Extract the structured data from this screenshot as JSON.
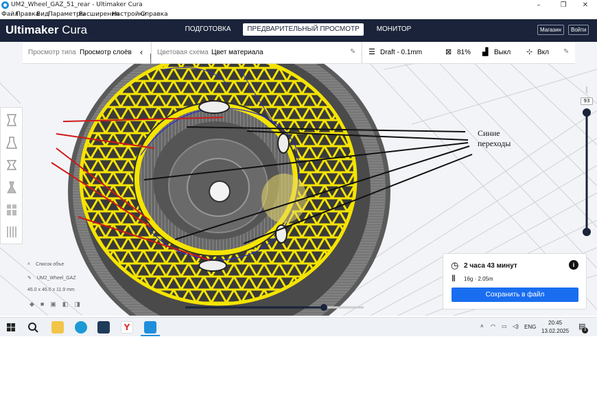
{
  "window": {
    "title": "UM2_Wheel_GAZ_51_rear - Ultimaker Cura",
    "controls": {
      "minimize": "–",
      "maximize": "❐",
      "close": "✕"
    }
  },
  "menu": {
    "items": [
      "Файл",
      "Правка",
      "Вид",
      "Параметры",
      "Расширения",
      "Настройки",
      "Справка"
    ]
  },
  "header": {
    "logo_bold": "Ultimaker",
    "logo_light": "Cura",
    "tabs": [
      "ПОДГОТОВКА",
      "ПРЕДВАРИТЕЛЬНЫЙ ПРОСМОТР",
      "МОНИТОР"
    ],
    "active_tab": 1,
    "marketplace": "Магазин",
    "signin": "Войти"
  },
  "view_bar": {
    "label": "Просмотр типа",
    "value": "Просмотр слоёв"
  },
  "color_bar": {
    "label": "Цветовая схема",
    "value": "Цвет материала"
  },
  "print_bar": {
    "profile": "Draft - 0.1mm",
    "infill": "81%",
    "support": "Выкл",
    "adhesion": "Вкл"
  },
  "object_list": {
    "header": "Список объе",
    "name": "UM2_Wheel_GAZ",
    "dims": "46.0 x 46.0 x 11.9 mm"
  },
  "layer_slider": {
    "value": "93"
  },
  "print_info": {
    "time": "2 часа 43 минут",
    "material": "16g · 2.05m",
    "save": "Сохранить в файл"
  },
  "annotation": {
    "line1": "Синие",
    "line2": "переходы"
  },
  "taskbar": {
    "lang": "ENG",
    "time": "20:45",
    "date": "13.02.2025",
    "notifications": "3"
  },
  "colors": {
    "header": "#1a2339",
    "accent": "#196ef0",
    "infill_yellow": "#f5e400",
    "wall_gray": "#6e6e6e"
  }
}
